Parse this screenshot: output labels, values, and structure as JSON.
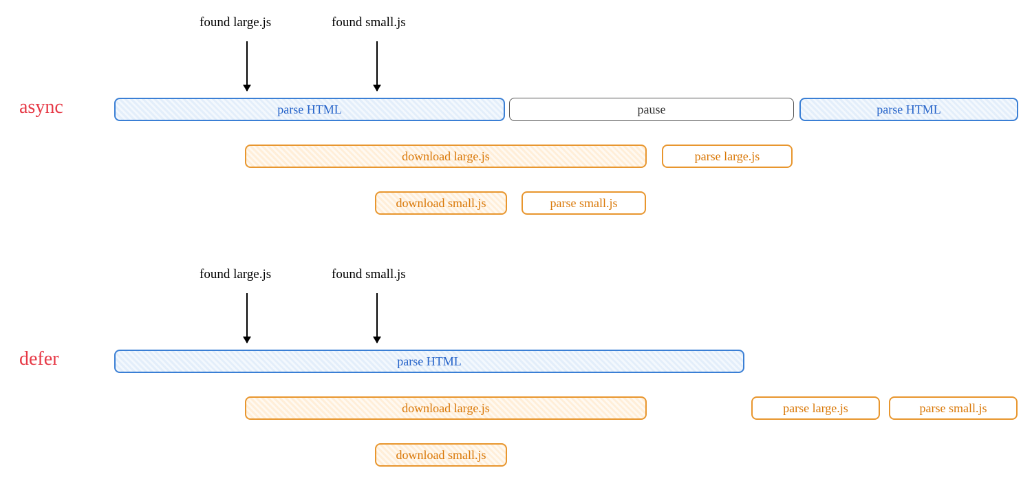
{
  "async": {
    "label": "async",
    "annotations": {
      "foundLarge": "found large.js",
      "foundSmall": "found small.js"
    },
    "row1": {
      "parseHtml1": "parse HTML",
      "pause": "pause",
      "parseHtml2": "parse HTML"
    },
    "row2": {
      "downloadLarge": "download large.js",
      "parseLarge": "parse large.js"
    },
    "row3": {
      "downloadSmall": "download small.js",
      "parseSmall": "parse small.js"
    }
  },
  "defer": {
    "label": "defer",
    "annotations": {
      "foundLarge": "found large.js",
      "foundSmall": "found small.js"
    },
    "row1": {
      "parseHtml": "parse HTML"
    },
    "row2": {
      "downloadLarge": "download large.js",
      "parseLarge": "parse large.js",
      "parseSmall": "parse small.js"
    },
    "row3": {
      "downloadSmall": "download small.js"
    }
  }
}
